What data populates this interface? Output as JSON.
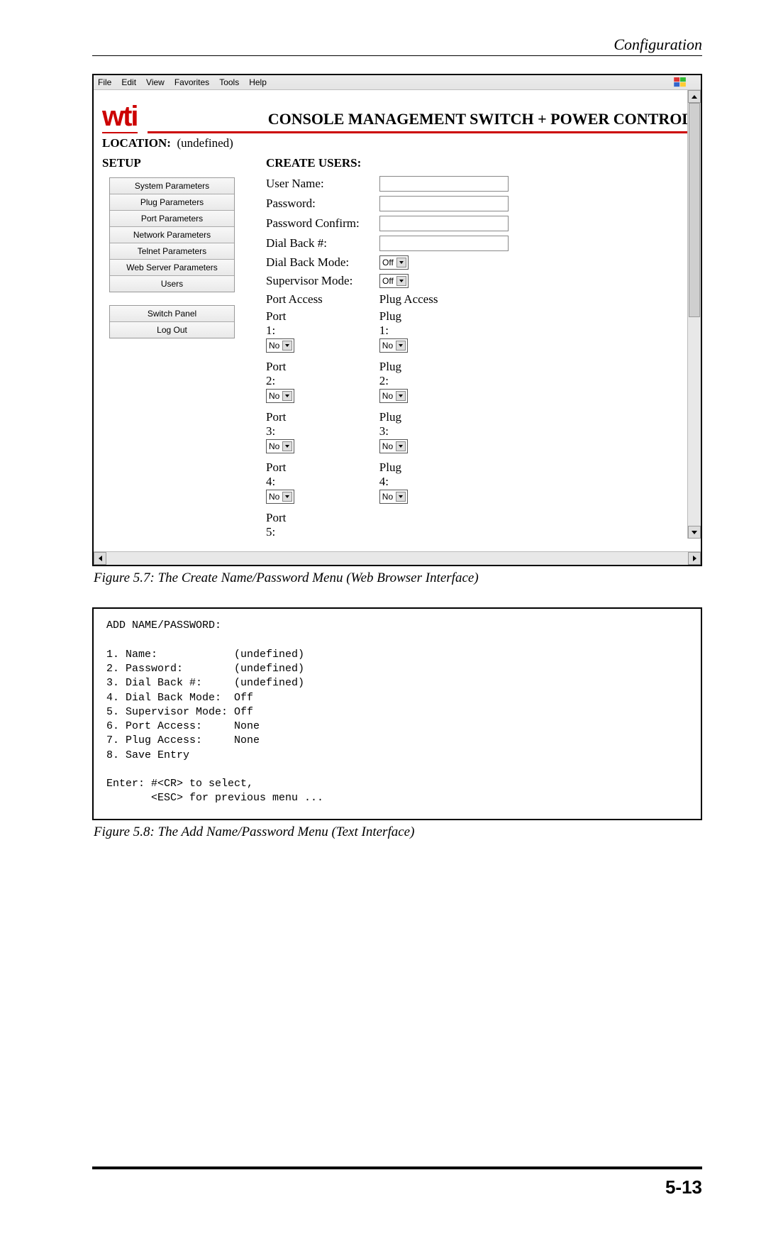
{
  "header": {
    "section": "Configuration"
  },
  "browser": {
    "menu": [
      "File",
      "Edit",
      "View",
      "Favorites",
      "Tools",
      "Help"
    ],
    "brand": "wti",
    "title": "CONSOLE MANAGEMENT SWITCH + POWER CONTROL",
    "location_label": "LOCATION:",
    "location_value": "(undefined)",
    "sidebar": {
      "heading": "SETUP",
      "items": [
        "System Parameters",
        "Plug Parameters",
        "Port Parameters",
        "Network Parameters",
        "Telnet Parameters",
        "Web Server Parameters",
        "Users"
      ],
      "items2": [
        "Switch Panel",
        "Log Out"
      ]
    },
    "form": {
      "heading": "CREATE USERS:",
      "rows": [
        {
          "label": "User Name:",
          "type": "text"
        },
        {
          "label": "Password:",
          "type": "text"
        },
        {
          "label": "Password Confirm:",
          "type": "text"
        },
        {
          "label": "Dial Back #:",
          "type": "text"
        },
        {
          "label": "Dial Back Mode:",
          "type": "select",
          "value": "Off"
        },
        {
          "label": "Supervisor Mode:",
          "type": "select",
          "value": "Off"
        }
      ],
      "port_heading": "Port Access",
      "plug_heading": "Plug Access",
      "ports": [
        {
          "label": "Port",
          "num": "1:",
          "value": "No"
        },
        {
          "label": "Port",
          "num": "2:",
          "value": "No"
        },
        {
          "label": "Port",
          "num": "3:",
          "value": "No"
        },
        {
          "label": "Port",
          "num": "4:",
          "value": "No"
        },
        {
          "label": "Port",
          "num": "5:",
          "value": ""
        }
      ],
      "plugs": [
        {
          "label": "Plug",
          "num": "1:",
          "value": "No"
        },
        {
          "label": "Plug",
          "num": "2:",
          "value": "No"
        },
        {
          "label": "Plug",
          "num": "3:",
          "value": "No"
        },
        {
          "label": "Plug",
          "num": "4:",
          "value": "No"
        }
      ]
    }
  },
  "figcap1": "Figure 5.7:  The Create Name/Password Menu  (Web Browser Interface)",
  "terminal": "ADD NAME/PASSWORD:\n\n1. Name:            (undefined)\n2. Password:        (undefined)\n3. Dial Back #:     (undefined)\n4. Dial Back Mode:  Off\n5. Supervisor Mode: Off\n6. Port Access:     None\n7. Plug Access:     None\n8. Save Entry\n\nEnter: #<CR> to select,\n       <ESC> for previous menu ...",
  "figcap2": "Figure 5.8:  The Add Name/Password Menu  (Text Interface)",
  "pagenum": "5-13"
}
